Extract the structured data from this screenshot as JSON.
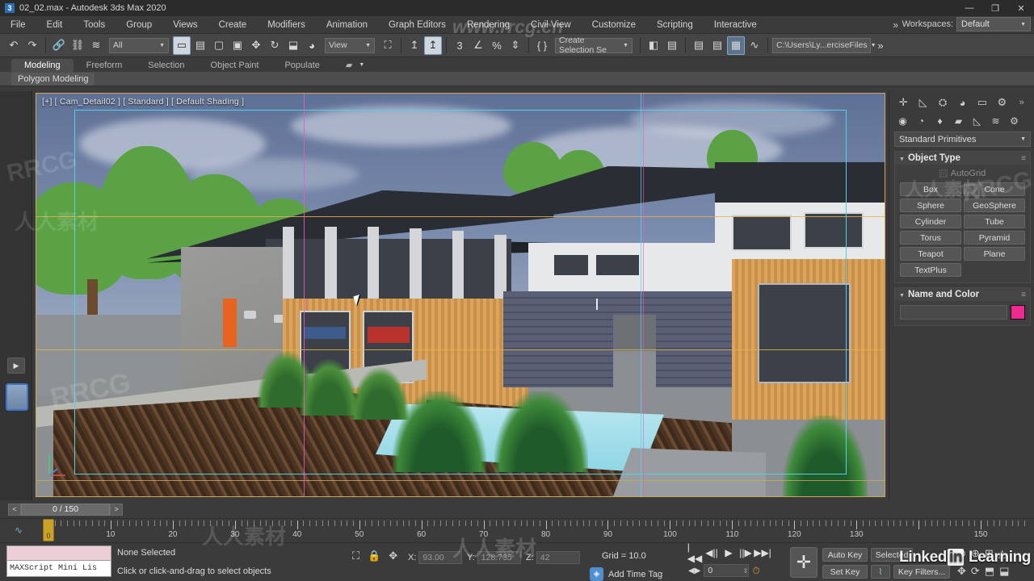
{
  "titlebar": {
    "title": "02_02.max - Autodesk 3ds Max 2020",
    "icon": "3",
    "minimize": "—",
    "maximize": "❐",
    "close": "✕"
  },
  "menubar": {
    "items": [
      "File",
      "Edit",
      "Tools",
      "Group",
      "Views",
      "Create",
      "Modifiers",
      "Animation",
      "Graph Editors",
      "Rendering",
      "Civil View",
      "Customize",
      "Scripting",
      "Interactive"
    ],
    "overflow": "»",
    "workspaces_label": "Workspaces:",
    "workspaces_value": "Default"
  },
  "toolbar": {
    "undo": "↶",
    "redo": "↷",
    "select_link": "🔗",
    "unlink": "⛓",
    "bind_space_warp": "≋",
    "selection_filter": "All",
    "select_object": "▭",
    "select_by_name": "▤",
    "select_region": "▢",
    "window_crossing": "▣",
    "select_move": "✥",
    "select_rotate": "↻",
    "select_scale": "⬓",
    "placement": "◕",
    "ref_coord_system": "View",
    "use_center": "⛶",
    "select_and_manipulate": "↥",
    "snap_toggle": "3",
    "angle_snap": "∠",
    "percent_snap": "%",
    "spinner_snap": "⇕",
    "edit_named_sets": "{ }",
    "named_selection_sets": "Create Selection Se",
    "mirror": "◧",
    "align": "▤",
    "layer_explorer": "▤",
    "scene_explorer": "▤",
    "toggle_ribbon": "▦",
    "curve_editor": "∿",
    "project_folder": "C:\\Users\\Ly...erciseFiles",
    "overflow": "»"
  },
  "ribbon": {
    "tabs": [
      "Modeling",
      "Freeform",
      "Selection",
      "Object Paint",
      "Populate"
    ],
    "active_tab": "Modeling",
    "dropdown_icon": "▰",
    "subtab": "Polygon Modeling"
  },
  "viewport": {
    "label": "[+] [ Cam_Detail02 ] [ Standard ] [ Default Shading ]"
  },
  "command_panel": {
    "tabs": [
      "create",
      "modify",
      "hierarchy",
      "motion",
      "display",
      "utilities"
    ],
    "tab_icons": [
      "✛",
      "◺",
      "⛭",
      "◕",
      "▭",
      "⚙"
    ],
    "tab_overflow": "»",
    "active_tab": "create",
    "category_icons": [
      "◉",
      "◔",
      "♦",
      "▰",
      "◺",
      "≋",
      "⚙"
    ],
    "active_category": 0,
    "subcategory": "Standard Primitives",
    "object_type": {
      "title": "Object Type",
      "autogrid": "AutoGrid",
      "buttons": [
        "Box",
        "Cone",
        "Sphere",
        "GeoSphere",
        "Cylinder",
        "Tube",
        "Torus",
        "Pyramid",
        "Teapot",
        "Plane",
        "TextPlus"
      ]
    },
    "name_and_color": {
      "title": "Name and Color",
      "name_value": "",
      "color": "#ef2a8e"
    }
  },
  "timeline": {
    "prev_key": "<",
    "frame_display": "0 / 150",
    "next_key": ">",
    "ticks": [
      0,
      10,
      20,
      30,
      40,
      50,
      60,
      70,
      80,
      90,
      100,
      110,
      120,
      130,
      150
    ],
    "current_frame": 0,
    "slider_label": "0"
  },
  "statusbar": {
    "maxscript_listener": "MAXScript Mini Lis",
    "selection_status": "None Selected",
    "hint": "Click or click-and-drag to select objects",
    "coords": {
      "x_label": "X:",
      "x_value": "93.00",
      "y_label": "Y:",
      "y_value": "128.735",
      "z_label": "Z:",
      "z_value": "42"
    },
    "grid": "Grid = 10.0",
    "add_time_tag": "Add Time Tag",
    "playback": {
      "go_to_start": "|◀◀",
      "prev_frame": "◀||",
      "play": "▶",
      "next_frame": "||▶",
      "go_to_end": "▶▶|",
      "key_mode": "◀▶",
      "frame_value": "0",
      "time_config": "⏱"
    },
    "auto_key": "Auto Key",
    "set_key": "Set Key",
    "selected": "Selected",
    "key_filters": "Key Filters...",
    "big_key_button": "✛"
  },
  "watermarks": {
    "linkedin": "Linked",
    "linkedin_in": "in",
    "linkedin_learning": "Learning",
    "site": "www.rrcg.cn",
    "rrcg": "RRCG",
    "cn": "人人素材"
  }
}
